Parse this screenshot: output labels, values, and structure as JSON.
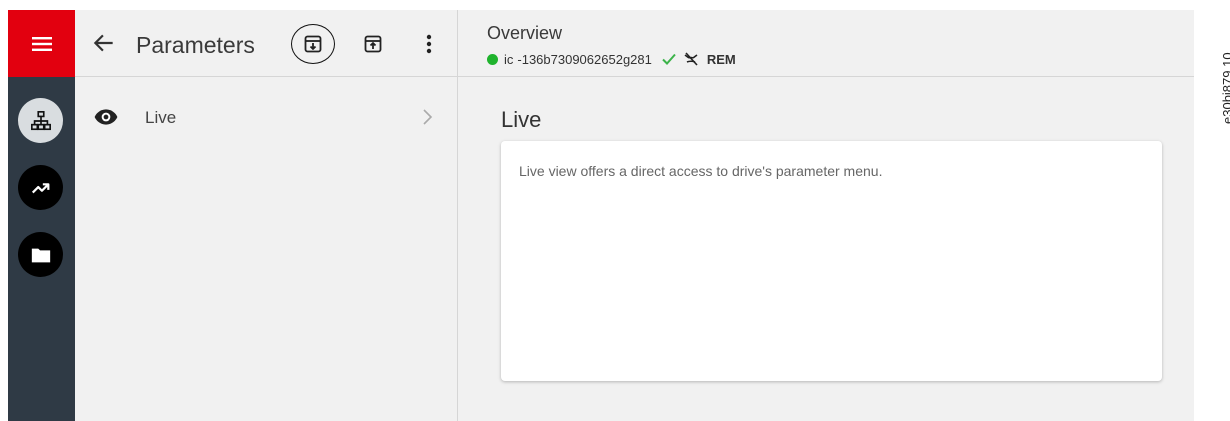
{
  "app": {
    "menu_icon": "hamburger-menu-icon",
    "accent_color": "#e2000f",
    "rail_color": "#2f3a45"
  },
  "rail": {
    "items": [
      {
        "icon": "network-tree-icon",
        "active": true
      },
      {
        "icon": "trend-chart-icon",
        "active": false
      },
      {
        "icon": "folder-icon",
        "active": false
      }
    ]
  },
  "parameters": {
    "title": "Parameters",
    "back_icon": "arrow-left-icon",
    "actions": [
      "download-icon",
      "upload-icon",
      "more-vert-icon"
    ],
    "items": [
      {
        "label": "Live",
        "icon": "eye-icon"
      }
    ]
  },
  "overview": {
    "title": "Overview",
    "connection_prefix": "ic",
    "device_id": "-136b7309062652g281",
    "status_color": "#1fb32d",
    "check_color": "#3cb34a",
    "mode": "REM"
  },
  "content": {
    "title": "Live",
    "description": "Live view offers a direct access to drive's parameter menu."
  },
  "figure_code": "e30bj879.10"
}
